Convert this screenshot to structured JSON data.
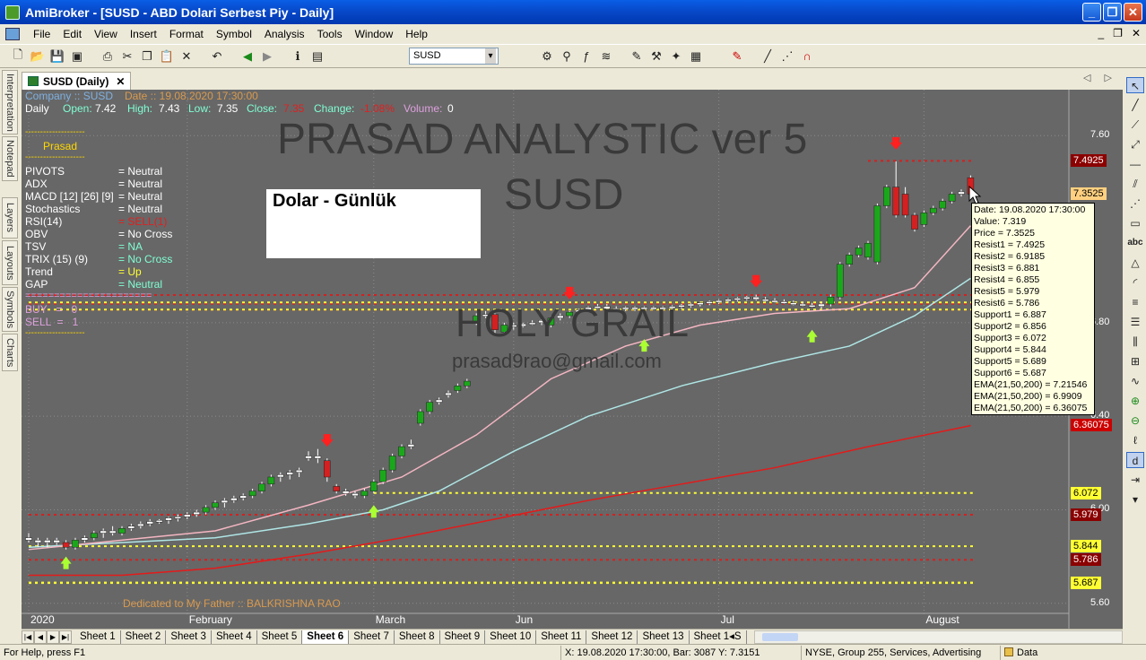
{
  "window": {
    "title": "AmiBroker - [SUSD - ABD Dolari Serbest Piy - Daily]",
    "minimize": "_",
    "maximize": "❐",
    "close": "✕"
  },
  "menu": {
    "items": [
      "File",
      "Edit",
      "View",
      "Insert",
      "Format",
      "Symbol",
      "Analysis",
      "Tools",
      "Window",
      "Help"
    ],
    "mdi": [
      "_",
      "❐",
      "✕"
    ]
  },
  "toolbar": {
    "symbol": "SUSD"
  },
  "left_tabs": [
    "Interpretation",
    "Notepad",
    "Layers",
    "Layouts",
    "Symbols",
    "Charts"
  ],
  "doc_tab": {
    "label": "SUSD (Daily)",
    "close": "✕",
    "nav": "◁ ▷"
  },
  "header": {
    "company": "Company :: SUSD",
    "date": "Date :: 19.08.2020 17:30:00",
    "period": "Daily",
    "open_lbl": "Open:",
    "open": "7.42",
    "high_lbl": "High:",
    "high": "7.43",
    "low_lbl": "Low:",
    "low": "7.35",
    "close_lbl": "Close:",
    "close": "7.35",
    "change_lbl": "Change:",
    "change": "-1.08%",
    "volume_lbl": "Volume:",
    "volume": "0"
  },
  "indicator_panel": {
    "dash1": "--------------------",
    "name": "Prasad",
    "dash2": "--------------------",
    "rows": [
      {
        "label": "PIVOTS",
        "value": "= Neutral",
        "color": "#ffffff"
      },
      {
        "label": "ADX",
        "value": "= Neutral",
        "color": "#ffffff"
      },
      {
        "label": "MACD [12] [26] [9]",
        "value": "= Neutral",
        "color": "#ffffff"
      },
      {
        "label": "Stochastics",
        "value": "= Neutral",
        "color": "#ffffff"
      },
      {
        "label": "RSI(14)",
        "value": "= SELL(1)",
        "color": "#e02020"
      },
      {
        "label": "OBV",
        "value": "= No Cross",
        "color": "#ffffff"
      },
      {
        "label": "TSV",
        "value": "= NA",
        "color": "#7fffd4"
      },
      {
        "label": "TRIX (15) (9)",
        "value": "= No Cross",
        "color": "#7fffd4"
      },
      {
        "label": "Trend",
        "value": "= Up",
        "color": "#ffff33"
      },
      {
        "label": "GAP",
        "value": "= Neutral",
        "color": "#7fffd4"
      }
    ],
    "separator": "======================",
    "buy": "BUY   =   0",
    "sell": "SELL  =   1",
    "dash3": "--------------------"
  },
  "overlay_text": {
    "title1": "PRASAD ANALYSTIC ver 5",
    "title2": "SUSD",
    "holy": "HOLY GRAIL",
    "email": "prasad9rao@gmail.com",
    "note": "Dolar  - Günlük",
    "dedicated": "Dedicated to My Father :: BALKRISHNA RAO"
  },
  "tooltip": {
    "lines": [
      "Date: 19.08.2020 17:30:00",
      "Value: 7.319",
      "Price = 7.3525",
      "Resist1 = 7.4925",
      "Resist2 = 6.9185",
      "Resist3 = 6.881",
      "Resist4 = 6.855",
      "Resist5 = 5.979",
      "Resist6 = 5.786",
      "Support1 = 6.887",
      "Support2 = 6.856",
      "Support3 = 6.072",
      "Support4 = 5.844",
      "Support5 = 5.689",
      "Support6 = 5.687",
      "EMA(21,50,200) = 7.21546",
      "EMA(21,50,200) = 6.9909",
      "EMA(21,50,200) = 6.36075"
    ]
  },
  "price_labels": [
    {
      "text": "7.4925",
      "bg": "#8b0000",
      "fg": "#ffffff",
      "price": 7.4925
    },
    {
      "text": "7.3525",
      "bg": "#ffd080",
      "fg": "#000000",
      "price": 7.3525
    },
    {
      "text": "6.36075",
      "bg": "#cc0000",
      "fg": "#ffffff",
      "price": 6.36075
    },
    {
      "text": "6.072",
      "bg": "#ffff33",
      "fg": "#000000",
      "price": 6.072
    },
    {
      "text": "5.979",
      "bg": "#8b0000",
      "fg": "#ffffff",
      "price": 5.979
    },
    {
      "text": "5.844",
      "bg": "#ffff33",
      "fg": "#000000",
      "price": 5.844
    },
    {
      "text": "5.786",
      "bg": "#8b0000",
      "fg": "#ffffff",
      "price": 5.786
    },
    {
      "text": "5.689",
      "bg": "#ffff33",
      "fg": "#000000",
      "price": 5.689
    },
    {
      "text": "5.687",
      "bg": "#ffff33",
      "fg": "#000000",
      "price": 5.687
    }
  ],
  "y_axis": [
    {
      "text": "7.60",
      "price": 7.6
    },
    {
      "text": "6.80",
      "price": 6.8
    },
    {
      "text": "6.40",
      "price": 6.4
    },
    {
      "text": "6.00",
      "price": 6.0
    },
    {
      "text": "5.60",
      "price": 5.6
    }
  ],
  "months": [
    {
      "text": "2020",
      "bar": 0
    },
    {
      "text": "February",
      "bar": 17
    },
    {
      "text": "March",
      "bar": 37
    },
    {
      "text": "Jun",
      "bar": 52
    },
    {
      "text": "Jul",
      "bar": 74
    },
    {
      "text": "August",
      "bar": 96
    }
  ],
  "sheets": [
    "Sheet 1",
    "Sheet 2",
    "Sheet 3",
    "Sheet 4",
    "Sheet 5",
    "Sheet 6",
    "Sheet 7",
    "Sheet 8",
    "Sheet 9",
    "Sheet 10",
    "Sheet 11",
    "Sheet 12",
    "Sheet 13",
    "Sheet 1◂S"
  ],
  "active_sheet": 5,
  "status": {
    "help": "For Help, press F1",
    "coords": "X: 19.08.2020 17:30:00, Bar: 3087   Y: 7.3151",
    "info": "NYSE, Group 255, Services, Advertising",
    "data": "Data"
  },
  "colors": {
    "chart_bg": "#676767",
    "up": "#1aa81a",
    "down": "#d42020",
    "resist_line": "#d42020",
    "support_line": "#ffff33",
    "ema21": "#f4b6c2",
    "ema50": "#b0e6e6",
    "ema200": "#e41a1a"
  },
  "chart_data": {
    "type": "candlestick",
    "y_range": [
      5.58,
      7.72
    ],
    "candles": [
      {
        "o": 5.88,
        "h": 5.9,
        "l": 5.86,
        "c": 5.87
      },
      {
        "o": 5.87,
        "h": 5.88,
        "l": 5.84,
        "c": 5.86
      },
      {
        "o": 5.86,
        "h": 5.88,
        "l": 5.84,
        "c": 5.87
      },
      {
        "o": 5.87,
        "h": 5.88,
        "l": 5.85,
        "c": 5.86
      },
      {
        "o": 5.86,
        "h": 5.87,
        "l": 5.83,
        "c": 5.84
      },
      {
        "o": 5.84,
        "h": 5.88,
        "l": 5.83,
        "c": 5.87
      },
      {
        "o": 5.87,
        "h": 5.89,
        "l": 5.86,
        "c": 5.88
      },
      {
        "o": 5.88,
        "h": 5.91,
        "l": 5.87,
        "c": 5.9
      },
      {
        "o": 5.9,
        "h": 5.92,
        "l": 5.88,
        "c": 5.91
      },
      {
        "o": 5.91,
        "h": 5.93,
        "l": 5.89,
        "c": 5.9
      },
      {
        "o": 5.9,
        "h": 5.93,
        "l": 5.89,
        "c": 5.92
      },
      {
        "o": 5.92,
        "h": 5.94,
        "l": 5.91,
        "c": 5.93
      },
      {
        "o": 5.93,
        "h": 5.95,
        "l": 5.92,
        "c": 5.94
      },
      {
        "o": 5.94,
        "h": 5.96,
        "l": 5.93,
        "c": 5.95
      },
      {
        "o": 5.95,
        "h": 5.96,
        "l": 5.94,
        "c": 5.955
      },
      {
        "o": 5.955,
        "h": 5.97,
        "l": 5.94,
        "c": 5.965
      },
      {
        "o": 5.965,
        "h": 5.98,
        "l": 5.95,
        "c": 5.97
      },
      {
        "o": 5.97,
        "h": 5.99,
        "l": 5.96,
        "c": 5.98
      },
      {
        "o": 5.98,
        "h": 6.0,
        "l": 5.97,
        "c": 5.99
      },
      {
        "o": 5.99,
        "h": 6.02,
        "l": 5.98,
        "c": 6.01
      },
      {
        "o": 6.01,
        "h": 6.04,
        "l": 6.0,
        "c": 6.03
      },
      {
        "o": 6.03,
        "h": 6.05,
        "l": 6.01,
        "c": 6.04
      },
      {
        "o": 6.04,
        "h": 6.06,
        "l": 6.03,
        "c": 6.05
      },
      {
        "o": 6.05,
        "h": 6.07,
        "l": 6.04,
        "c": 6.06
      },
      {
        "o": 6.06,
        "h": 6.09,
        "l": 6.05,
        "c": 6.08
      },
      {
        "o": 6.08,
        "h": 6.12,
        "l": 6.07,
        "c": 6.11
      },
      {
        "o": 6.11,
        "h": 6.15,
        "l": 6.1,
        "c": 6.14
      },
      {
        "o": 6.14,
        "h": 6.16,
        "l": 6.12,
        "c": 6.15
      },
      {
        "o": 6.15,
        "h": 6.17,
        "l": 6.13,
        "c": 6.16
      },
      {
        "o": 6.16,
        "h": 6.18,
        "l": 6.14,
        "c": 6.17
      },
      {
        "o": 6.23,
        "h": 6.25,
        "l": 6.21,
        "c": 6.22
      },
      {
        "o": 6.23,
        "h": 6.26,
        "l": 6.2,
        "c": 6.22
      },
      {
        "o": 6.21,
        "h": 6.22,
        "l": 6.12,
        "c": 6.14
      },
      {
        "o": 6.1,
        "h": 6.11,
        "l": 6.07,
        "c": 6.08
      },
      {
        "o": 6.08,
        "h": 6.09,
        "l": 6.06,
        "c": 6.07
      },
      {
        "o": 6.07,
        "h": 6.08,
        "l": 6.05,
        "c": 6.06
      },
      {
        "o": 6.06,
        "h": 6.09,
        "l": 6.05,
        "c": 6.08
      },
      {
        "o": 6.08,
        "h": 6.13,
        "l": 6.07,
        "c": 6.12
      },
      {
        "o": 6.12,
        "h": 6.18,
        "l": 6.11,
        "c": 6.17
      },
      {
        "o": 6.17,
        "h": 6.24,
        "l": 6.16,
        "c": 6.23
      },
      {
        "o": 6.23,
        "h": 6.28,
        "l": 6.22,
        "c": 6.27
      },
      {
        "o": 6.27,
        "h": 6.3,
        "l": 6.26,
        "c": 6.28
      },
      {
        "o": 6.37,
        "h": 6.43,
        "l": 6.36,
        "c": 6.42
      },
      {
        "o": 6.42,
        "h": 6.47,
        "l": 6.41,
        "c": 6.46
      },
      {
        "o": 6.46,
        "h": 6.48,
        "l": 6.45,
        "c": 6.47
      },
      {
        "o": 6.49,
        "h": 6.51,
        "l": 6.48,
        "c": 6.5
      },
      {
        "o": 6.51,
        "h": 6.54,
        "l": 6.5,
        "c": 6.53
      },
      {
        "o": 6.53,
        "h": 6.56,
        "l": 6.52,
        "c": 6.55
      },
      {
        "o": 6.8,
        "h": 6.84,
        "l": 6.79,
        "c": 6.83
      },
      {
        "o": 6.83,
        "h": 6.85,
        "l": 6.82,
        "c": 6.835
      },
      {
        "o": 6.835,
        "h": 6.84,
        "l": 6.75,
        "c": 6.77
      },
      {
        "o": 6.76,
        "h": 6.8,
        "l": 6.75,
        "c": 6.79
      },
      {
        "o": 6.79,
        "h": 6.8,
        "l": 6.77,
        "c": 6.785
      },
      {
        "o": 6.785,
        "h": 6.8,
        "l": 6.78,
        "c": 6.795
      },
      {
        "o": 6.795,
        "h": 6.81,
        "l": 6.79,
        "c": 6.8
      },
      {
        "o": 6.8,
        "h": 6.82,
        "l": 6.79,
        "c": 6.81
      },
      {
        "o": 6.79,
        "h": 6.83,
        "l": 6.78,
        "c": 6.82
      },
      {
        "o": 6.82,
        "h": 6.84,
        "l": 6.81,
        "c": 6.83
      },
      {
        "o": 6.83,
        "h": 6.85,
        "l": 6.82,
        "c": 6.845
      },
      {
        "o": 6.845,
        "h": 6.86,
        "l": 6.84,
        "c": 6.855
      },
      {
        "o": 6.855,
        "h": 6.87,
        "l": 6.85,
        "c": 6.865
      },
      {
        "o": 6.865,
        "h": 6.88,
        "l": 6.86,
        "c": 6.87
      },
      {
        "o": 6.87,
        "h": 6.88,
        "l": 6.85,
        "c": 6.86
      },
      {
        "o": 6.86,
        "h": 6.87,
        "l": 6.85,
        "c": 6.86
      },
      {
        "o": 6.86,
        "h": 6.87,
        "l": 6.85,
        "c": 6.865
      },
      {
        "o": 6.865,
        "h": 6.87,
        "l": 6.85,
        "c": 6.86
      },
      {
        "o": 6.86,
        "h": 6.87,
        "l": 6.85,
        "c": 6.865
      },
      {
        "o": 6.865,
        "h": 6.87,
        "l": 6.855,
        "c": 6.86
      },
      {
        "o": 6.86,
        "h": 6.87,
        "l": 6.85,
        "c": 6.865
      },
      {
        "o": 6.865,
        "h": 6.875,
        "l": 6.855,
        "c": 6.87
      },
      {
        "o": 6.87,
        "h": 6.88,
        "l": 6.86,
        "c": 6.875
      },
      {
        "o": 6.875,
        "h": 6.885,
        "l": 6.865,
        "c": 6.88
      },
      {
        "o": 6.88,
        "h": 6.89,
        "l": 6.87,
        "c": 6.885
      },
      {
        "o": 6.885,
        "h": 6.895,
        "l": 6.875,
        "c": 6.89
      },
      {
        "o": 6.89,
        "h": 6.9,
        "l": 6.88,
        "c": 6.895
      },
      {
        "o": 6.895,
        "h": 6.905,
        "l": 6.885,
        "c": 6.9
      },
      {
        "o": 6.9,
        "h": 6.91,
        "l": 6.89,
        "c": 6.905
      },
      {
        "o": 6.905,
        "h": 6.915,
        "l": 6.895,
        "c": 6.91
      },
      {
        "o": 6.91,
        "h": 6.92,
        "l": 6.895,
        "c": 6.9
      },
      {
        "o": 6.9,
        "h": 6.91,
        "l": 6.89,
        "c": 6.895
      },
      {
        "o": 6.895,
        "h": 6.905,
        "l": 6.885,
        "c": 6.89
      },
      {
        "o": 6.89,
        "h": 6.9,
        "l": 6.88,
        "c": 6.885
      },
      {
        "o": 6.885,
        "h": 6.895,
        "l": 6.875,
        "c": 6.88
      },
      {
        "o": 6.88,
        "h": 6.89,
        "l": 6.87,
        "c": 6.875
      },
      {
        "o": 6.875,
        "h": 6.885,
        "l": 6.865,
        "c": 6.87
      },
      {
        "o": 6.87,
        "h": 6.89,
        "l": 6.86,
        "c": 6.88
      },
      {
        "o": 6.88,
        "h": 6.92,
        "l": 6.87,
        "c": 6.91
      },
      {
        "o": 6.91,
        "h": 7.06,
        "l": 6.9,
        "c": 7.05
      },
      {
        "o": 7.05,
        "h": 7.1,
        "l": 7.04,
        "c": 7.09
      },
      {
        "o": 7.09,
        "h": 7.13,
        "l": 7.08,
        "c": 7.12
      },
      {
        "o": 7.08,
        "h": 7.15,
        "l": 7.07,
        "c": 7.14
      },
      {
        "o": 7.06,
        "h": 7.31,
        "l": 7.05,
        "c": 7.3
      },
      {
        "o": 7.3,
        "h": 7.39,
        "l": 7.29,
        "c": 7.38
      },
      {
        "o": 7.38,
        "h": 7.49,
        "l": 7.25,
        "c": 7.26
      },
      {
        "o": 7.35,
        "h": 7.38,
        "l": 7.25,
        "c": 7.26
      },
      {
        "o": 7.26,
        "h": 7.27,
        "l": 7.19,
        "c": 7.2
      },
      {
        "o": 7.22,
        "h": 7.28,
        "l": 7.21,
        "c": 7.27
      },
      {
        "o": 7.27,
        "h": 7.3,
        "l": 7.26,
        "c": 7.29
      },
      {
        "o": 7.29,
        "h": 7.33,
        "l": 7.28,
        "c": 7.32
      },
      {
        "o": 7.32,
        "h": 7.36,
        "l": 7.31,
        "c": 7.35
      },
      {
        "o": 7.35,
        "h": 7.37,
        "l": 7.34,
        "c": 7.36
      },
      {
        "o": 7.42,
        "h": 7.43,
        "l": 7.35,
        "c": 7.35
      }
    ],
    "ema21": {
      "start": [
        0,
        5.83
      ],
      "points": [
        [
          0,
          5.83
        ],
        [
          20,
          5.91
        ],
        [
          30,
          6.02
        ],
        [
          40,
          6.14
        ],
        [
          48,
          6.32
        ],
        [
          56,
          6.56
        ],
        [
          64,
          6.7
        ],
        [
          72,
          6.79
        ],
        [
          80,
          6.84
        ],
        [
          88,
          6.86
        ],
        [
          95,
          6.95
        ],
        [
          101,
          7.215
        ]
      ]
    },
    "ema50": {
      "start": [
        0,
        5.84
      ],
      "points": [
        [
          0,
          5.84
        ],
        [
          20,
          5.88
        ],
        [
          30,
          5.94
        ],
        [
          38,
          6.0
        ],
        [
          44,
          6.08
        ],
        [
          52,
          6.25
        ],
        [
          60,
          6.4
        ],
        [
          70,
          6.53
        ],
        [
          80,
          6.63
        ],
        [
          88,
          6.7
        ],
        [
          95,
          6.83
        ],
        [
          101,
          6.99
        ]
      ]
    },
    "ema200": {
      "points": [
        [
          0,
          5.72
        ],
        [
          10,
          5.72
        ],
        [
          20,
          5.75
        ],
        [
          30,
          5.81
        ],
        [
          40,
          5.88
        ],
        [
          50,
          5.96
        ],
        [
          60,
          6.04
        ],
        [
          70,
          6.11
        ],
        [
          80,
          6.18
        ],
        [
          90,
          6.27
        ],
        [
          101,
          6.36
        ]
      ]
    },
    "resist_lines": [
      {
        "price": 7.4925,
        "from": 90
      },
      {
        "price": 6.9185,
        "from": 0
      },
      {
        "price": 6.881,
        "from": 0
      },
      {
        "price": 6.855,
        "from": 0
      },
      {
        "price": 5.979,
        "from": 0
      },
      {
        "price": 5.786,
        "from": 0
      }
    ],
    "support_lines": [
      {
        "price": 6.887,
        "from": 0
      },
      {
        "price": 6.856,
        "from": 0
      },
      {
        "price": 6.072,
        "from": 37
      },
      {
        "price": 5.844,
        "from": 0
      },
      {
        "price": 5.689,
        "from": 0
      },
      {
        "price": 5.687,
        "from": 0
      }
    ],
    "sell_arrows": [
      {
        "bar": 32,
        "price": 6.27
      },
      {
        "bar": 58,
        "price": 6.9
      },
      {
        "bar": 78,
        "price": 6.95
      },
      {
        "bar": 93,
        "price": 7.54
      }
    ],
    "buy_arrows": [
      {
        "bar": 4,
        "price": 5.8
      },
      {
        "bar": 37,
        "price": 6.02
      },
      {
        "bar": 66,
        "price": 6.73
      },
      {
        "bar": 84,
        "price": 6.77
      }
    ]
  }
}
